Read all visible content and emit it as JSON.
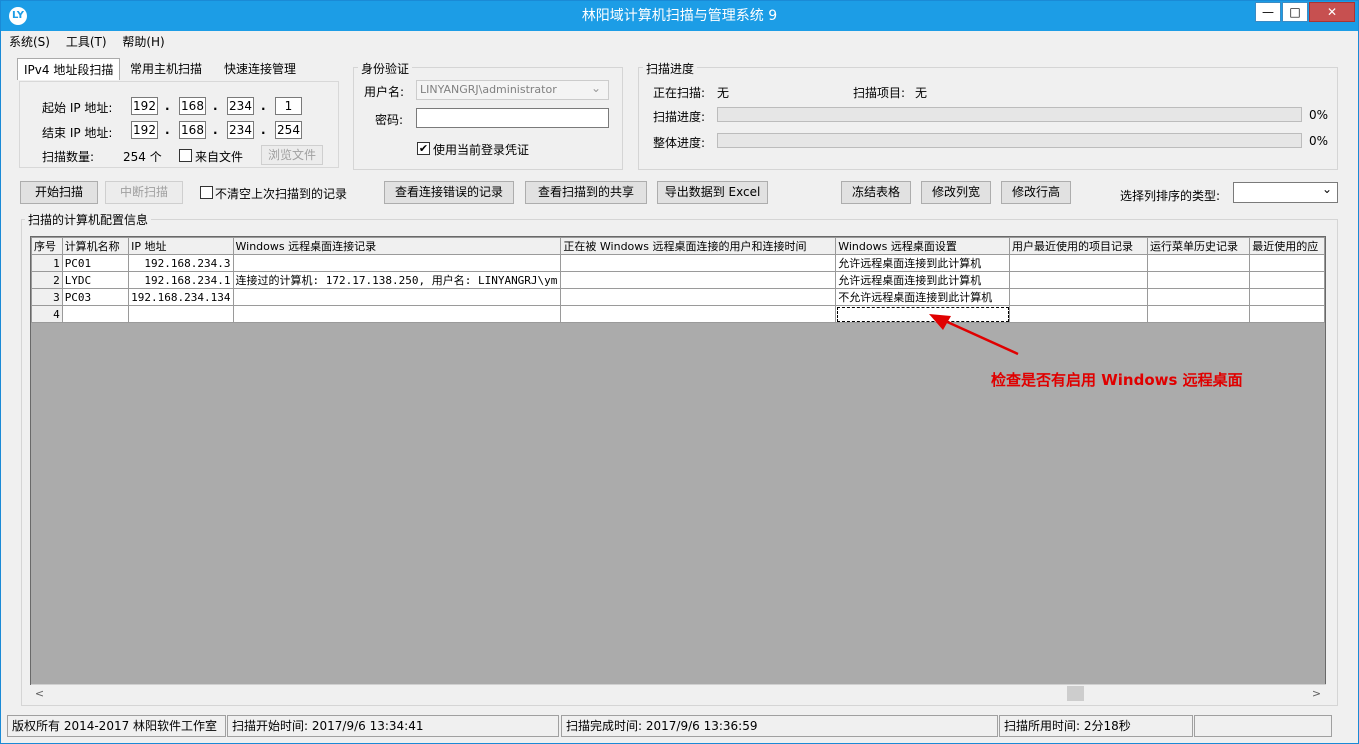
{
  "window": {
    "title": "林阳域计算机扫描与管理系统 9",
    "app_icon": "LY",
    "minimize": "—",
    "maximize": "□",
    "close": "✕"
  },
  "menu": [
    "系统(S)",
    "工具(T)",
    "帮助(H)"
  ],
  "tabs": [
    "IPv4 地址段扫描",
    "常用主机扫描",
    "快速连接管理"
  ],
  "ip_scan": {
    "start_label": "起始 IP 地址:",
    "end_label": "结束 IP 地址:",
    "start_ip": [
      "192",
      "168",
      "234",
      "1"
    ],
    "end_ip": [
      "192",
      "168",
      "234",
      "254"
    ],
    "count_label": "扫描数量:",
    "count_value": "254 个",
    "from_file_label": "来自文件",
    "browse_button": "浏览文件"
  },
  "auth": {
    "group_title": "身份验证",
    "username_label": "用户名:",
    "username_value": "LINYANGRJ\\administrator",
    "password_label": "密码:",
    "use_current_label": "使用当前登录凭证",
    "use_current_checked": "✔"
  },
  "progress": {
    "group_title": "扫描进度",
    "scanning_label": "正在扫描:",
    "scanning_value": "无",
    "item_label": "扫描项目:",
    "item_value": "无",
    "scan_progress_label": "扫描进度:",
    "scan_progress_pct": "0%",
    "overall_label": "整体进度:",
    "overall_pct": "0%"
  },
  "toolbar": {
    "start": "开始扫描",
    "stop": "中断扫描",
    "keep_last_label": "不清空上次扫描到的记录",
    "view_errors": "查看连接错误的记录",
    "view_shares": "查看扫描到的共享",
    "export_excel": "导出数据到 Excel",
    "freeze": "冻结表格",
    "col_width": "修改列宽",
    "row_height": "修改行高",
    "sort_label": "选择列排序的类型:",
    "sort_value": "",
    "sort_arrow": "⌄"
  },
  "grid": {
    "section_title": "扫描的计算机配置信息",
    "columns": [
      "序号",
      "计算机名称",
      "IP 地址",
      "Windows 远程桌面连接记录",
      "正在被 Windows 远程桌面连接的用户和连接时间",
      "Windows 远程桌面设置",
      "用户最近使用的项目记录",
      "运行菜单历史记录",
      "最近使用的应"
    ],
    "rows": [
      [
        "1",
        "PC01",
        "192.168.234.3",
        "",
        "",
        "允许远程桌面连接到此计算机",
        "",
        "",
        ""
      ],
      [
        "2",
        "LYDC",
        "192.168.234.1",
        "连接过的计算机: 172.17.138.250, 用户名: LINYANGRJ\\ym",
        "",
        "允许远程桌面连接到此计算机",
        "",
        "",
        ""
      ],
      [
        "3",
        "PC03",
        "192.168.234.134",
        "",
        "",
        "不允许远程桌面连接到此计算机",
        "",
        "",
        ""
      ],
      [
        "4",
        "",
        "",
        "",
        "",
        "",
        "",
        "",
        ""
      ]
    ],
    "scroll_left": "<",
    "scroll_right": ">"
  },
  "annotation": "检查是否有启用 Windows 远程桌面",
  "colors": {
    "accent": "#1c9de6",
    "annotation": "#e00000"
  },
  "status": {
    "copyright": "版权所有 2014-2017 林阳软件工作室",
    "start_time": "扫描开始时间: 2017/9/6 13:34:41",
    "end_time": "扫描完成时间: 2017/9/6 13:36:59",
    "elapsed": "扫描所用时间: 2分18秒",
    "extra": ""
  }
}
